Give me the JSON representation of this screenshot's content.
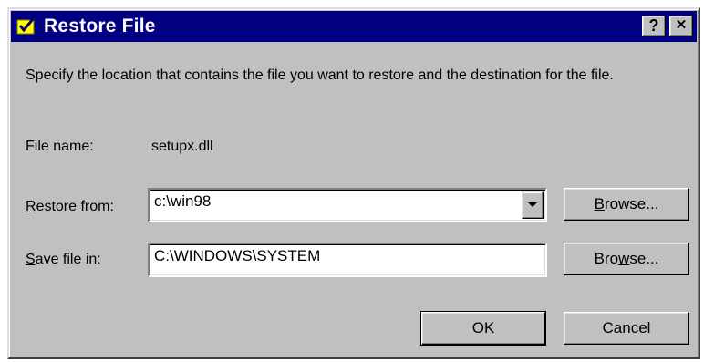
{
  "window": {
    "title": "Restore File",
    "help_label": "?",
    "close_label": "✕"
  },
  "description": "Specify the location that contains the file you want to restore and the destination for the file.",
  "file_name": {
    "label": "File name:",
    "value": "setupx.dll"
  },
  "restore_from": {
    "label_first": "R",
    "label_rest": "estore from:",
    "value": "c:\\win98",
    "browse_pre": "B",
    "browse_rest": "rowse..."
  },
  "save_file_in": {
    "label_first": "S",
    "label_rest": "ave file in:",
    "value": "C:\\WINDOWS\\SYSTEM",
    "browse_pre": "Bro",
    "browse_u": "w",
    "browse_rest": "se..."
  },
  "ok_label": "OK",
  "cancel_label": "Cancel"
}
